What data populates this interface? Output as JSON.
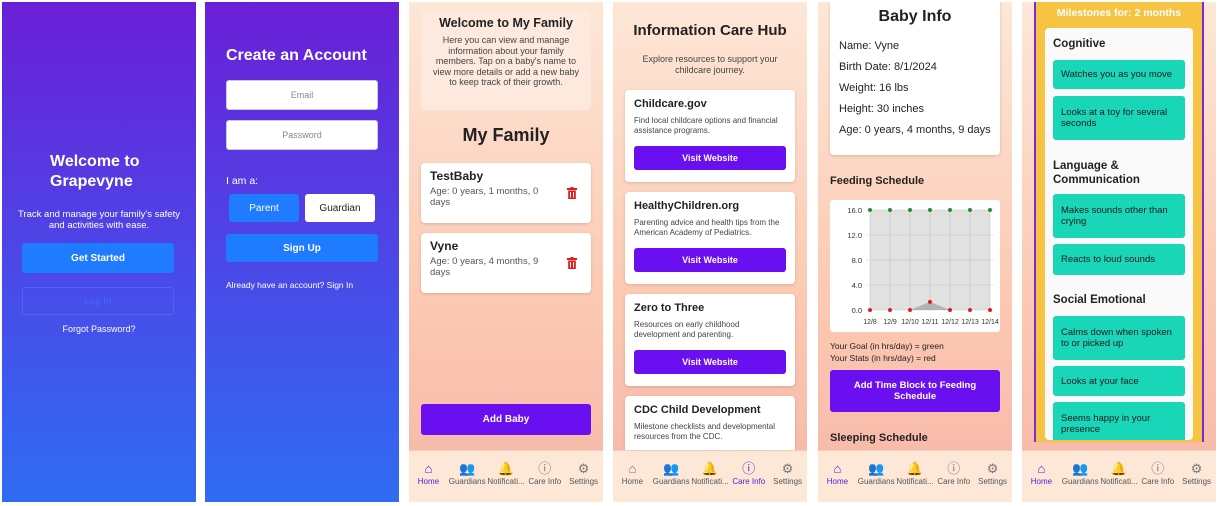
{
  "welcome": {
    "title": "Welcome to Grapevyne",
    "subtitle": "Track and manage your family's safety and activities with ease.",
    "get_started": "Get Started",
    "log_in": "Log In",
    "forgot": "Forgot Password?"
  },
  "create": {
    "title": "Create an Account",
    "email_placeholder": "Email",
    "password_placeholder": "Password",
    "i_am": "I am a:",
    "parent": "Parent",
    "guardian": "Guardian",
    "sign_up": "Sign Up",
    "signin_link": "Already have an account? Sign In"
  },
  "family": {
    "welcome_title": "Welcome to My Family",
    "welcome_text": "Here you can view and manage information about your family members. Tap on a baby's name to view more details or add a new baby to keep track of their growth.",
    "heading": "My Family",
    "babies": [
      {
        "name": "TestBaby",
        "age": "Age: 0 years, 1 months, 0 days"
      },
      {
        "name": "Vyne",
        "age": "Age: 0 years, 4 months, 9 days"
      }
    ],
    "add_baby": "Add Baby"
  },
  "hub": {
    "title": "Information Care Hub",
    "subtitle": "Explore resources to support your childcare journey.",
    "visit": "Visit Website",
    "resources": [
      {
        "name": "Childcare.gov",
        "desc": "Find local childcare options and financial assistance programs."
      },
      {
        "name": "HealthyChildren.org",
        "desc": "Parenting advice and health tips from the American Academy of Pediatrics."
      },
      {
        "name": "Zero to Three",
        "desc": "Resources on early childhood development and parenting."
      },
      {
        "name": "CDC Child Development",
        "desc": "Milestone checklists and developmental resources from the CDC."
      }
    ]
  },
  "baby": {
    "title": "Baby Info",
    "name": "Name: Vyne",
    "birth": "Birth Date: 8/1/2024",
    "weight": "Weight: 16 lbs",
    "height": "Height: 30 inches",
    "age": "Age: 0 years, 4 months, 9 days",
    "feeding_title": "Feeding Schedule",
    "goal_legend": "Your Goal (in hrs/day) = green",
    "stats_legend": "Your Stats (in hrs/day) = red",
    "add_block": "Add Time Block to Feeding Schedule",
    "sleeping_title": "Sleeping Schedule",
    "colors": {
      "goal": "#2e8b2e",
      "stats": "#e01b1b"
    }
  },
  "chart_data": {
    "type": "line",
    "x": [
      "12/8",
      "12/9",
      "12/10",
      "12/11",
      "12/12",
      "12/13",
      "12/14"
    ],
    "series": [
      {
        "values": [
          16,
          16,
          16,
          16,
          16,
          16,
          16
        ]
      },
      {
        "values": [
          0,
          0,
          0,
          1.3,
          0,
          0,
          0
        ]
      }
    ],
    "yticks": [
      "16.0",
      "12.0",
      "8.0",
      "4.0",
      "0.0"
    ],
    "ylim": [
      0,
      16
    ],
    "grid": true
  },
  "milestones": {
    "header": "Milestones for: 2 months",
    "sections": [
      {
        "title": "Cognitive",
        "items": [
          "Watches you as you move",
          "Looks at a toy for several seconds"
        ]
      },
      {
        "title": "Language & Communication",
        "items": [
          "Makes sounds other than crying",
          "Reacts to loud sounds"
        ]
      },
      {
        "title": "Social Emotional",
        "items": [
          "Calms down when spoken to or picked up",
          "Looks at your face",
          "Seems happy in your presence"
        ]
      }
    ]
  },
  "nav": {
    "home": "Home",
    "guardians": "Guardians",
    "notifications": "Notificati...",
    "care_info": "Care Info",
    "settings": "Settings"
  }
}
